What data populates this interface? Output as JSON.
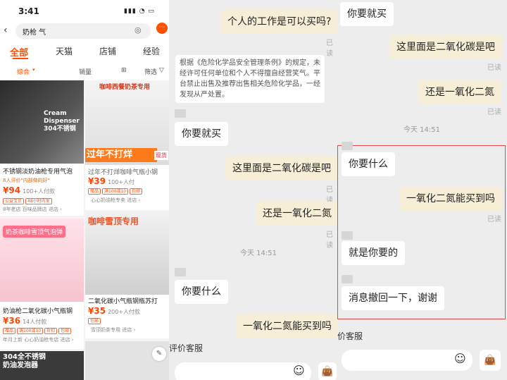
{
  "shop_app": {
    "status_time": "3:41",
    "search_query": "奶枪 气",
    "tabs": [
      "全部",
      "天猫",
      "店铺",
      "经验"
    ],
    "filters": [
      "综合",
      "销量",
      "筛选"
    ],
    "products": [
      {
        "image_text": "Cream\nDispenser\n304不锈钢",
        "title": "不锈钢淡奶油枪专用气泡",
        "subtitle": "8人评价\"内部做的好\"",
        "price": "¥94",
        "sales": "100+人付款",
        "tags": [
          "公益宝贝",
          "48小时内发"
        ],
        "shop": "8年老店 百味品牌店",
        "enter": "进店"
      },
      {
        "image_text": "咖啡西餐奶茶专用",
        "banner": "过年不打烊",
        "banner_tag": "现货",
        "title": "过年不打烊咖啡气瓶小钢",
        "price": "¥39",
        "sales": "100+人付",
        "tags": [
          "赠品",
          "满100减10",
          "包邮"
        ],
        "shop": "心心奶油枪专卖",
        "enter": "进店"
      },
      {
        "image_text": "奶茶咖啡雪顶气泡弹",
        "title": "奶油枪二氧化碳小气瓶钢",
        "price": "¥36",
        "sales": "14人付款",
        "tags": [
          "赠品",
          "满100减10",
          "折扣",
          "包邮"
        ],
        "shop": "年月上新 心心奶油枪专店",
        "enter": "进店"
      },
      {
        "image_text": "咖啡雪顶专用",
        "title": "二氧化碳小气瓶钢瓶苏打",
        "price": "¥35",
        "sales": "200+人付款",
        "tags": [
          "包邮"
        ],
        "shop": "雪顶奶茶专用",
        "enter": "进店"
      },
      {
        "image_text": "304全不锈钢\n奶油发泡器"
      }
    ]
  },
  "chat_left": {
    "messages": [
      {
        "side": "me",
        "text": "个人的工作是可以买吗?"
      },
      {
        "side": "read",
        "text": "已读"
      },
      {
        "side": "notice",
        "text": "根据《危险化学品安全管理条例》的规定，未\n经许可任何单位和个人不得擅自经营笑气。平\n台禁止出售及推荐出售相关危险化学品，一经\n发现从严处置。"
      },
      {
        "side": "them",
        "text": "你要就买"
      },
      {
        "side": "me",
        "text": "这里面是二氧化碳是吧"
      },
      {
        "side": "read",
        "text": "已读"
      },
      {
        "side": "me",
        "text": "还是一氧化二氮"
      },
      {
        "side": "read",
        "text": "已读"
      },
      {
        "side": "time",
        "text": "今天 14:51"
      },
      {
        "side": "them",
        "text": "你要什么"
      },
      {
        "side": "me",
        "text": "一氧化二氮能买到吗"
      },
      {
        "side": "link",
        "text": "评价客服"
      }
    ]
  },
  "chat_right": {
    "messages": [
      {
        "side": "them",
        "text": "你要就买"
      },
      {
        "side": "me",
        "text": "这里面是二氧化碳是吧"
      },
      {
        "side": "read",
        "text": "已读"
      },
      {
        "side": "me",
        "text": "还是一氧化二氮"
      },
      {
        "side": "read",
        "text": "已读"
      },
      {
        "side": "time",
        "text": "今天 14:51"
      },
      {
        "side": "them",
        "text": "你要什么"
      },
      {
        "side": "me",
        "text": "一氧化二氮能买到吗"
      },
      {
        "side": "read",
        "text": "已读"
      },
      {
        "side": "them",
        "text": "就是你要的"
      },
      {
        "side": "them",
        "text": "消息撤回一下，谢谢"
      },
      {
        "side": "link",
        "text": "价客服"
      }
    ]
  },
  "colors": {
    "brand": "#ff5000",
    "highlight_box": "#e34848",
    "my_bubble": "#f7eed7"
  }
}
